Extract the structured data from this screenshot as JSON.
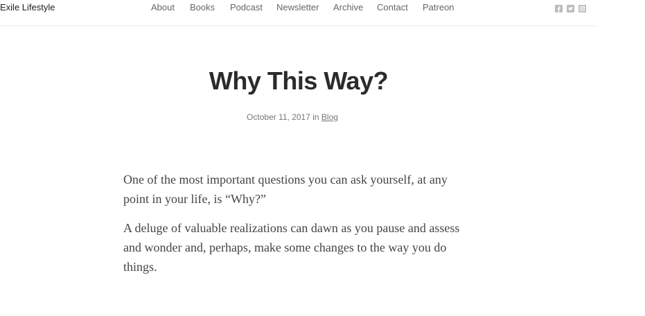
{
  "header": {
    "site_title": "Exile Lifestyle",
    "nav": [
      {
        "label": "About"
      },
      {
        "label": "Books"
      },
      {
        "label": "Podcast"
      },
      {
        "label": "Newsletter"
      },
      {
        "label": "Archive"
      },
      {
        "label": "Contact"
      },
      {
        "label": "Patreon"
      }
    ],
    "social_icons": [
      "facebook-icon",
      "twitter-icon",
      "instagram-icon"
    ]
  },
  "post": {
    "title": "Why This Way?",
    "date": "October 11, 2017",
    "in_word": "in",
    "category": "Blog",
    "paragraphs": [
      "One of the most important questions you can ask yourself, at any point in your life, is “Why?”",
      "A deluge of valuable realizations can dawn as you pause and assess and wonder and, perhaps, make some changes to the way you do things."
    ]
  },
  "colors": {
    "title": "#2b2b2b",
    "nav_text": "#666666",
    "body_text": "#444444",
    "meta_text": "#777777",
    "icon": "#bbbbbb"
  }
}
